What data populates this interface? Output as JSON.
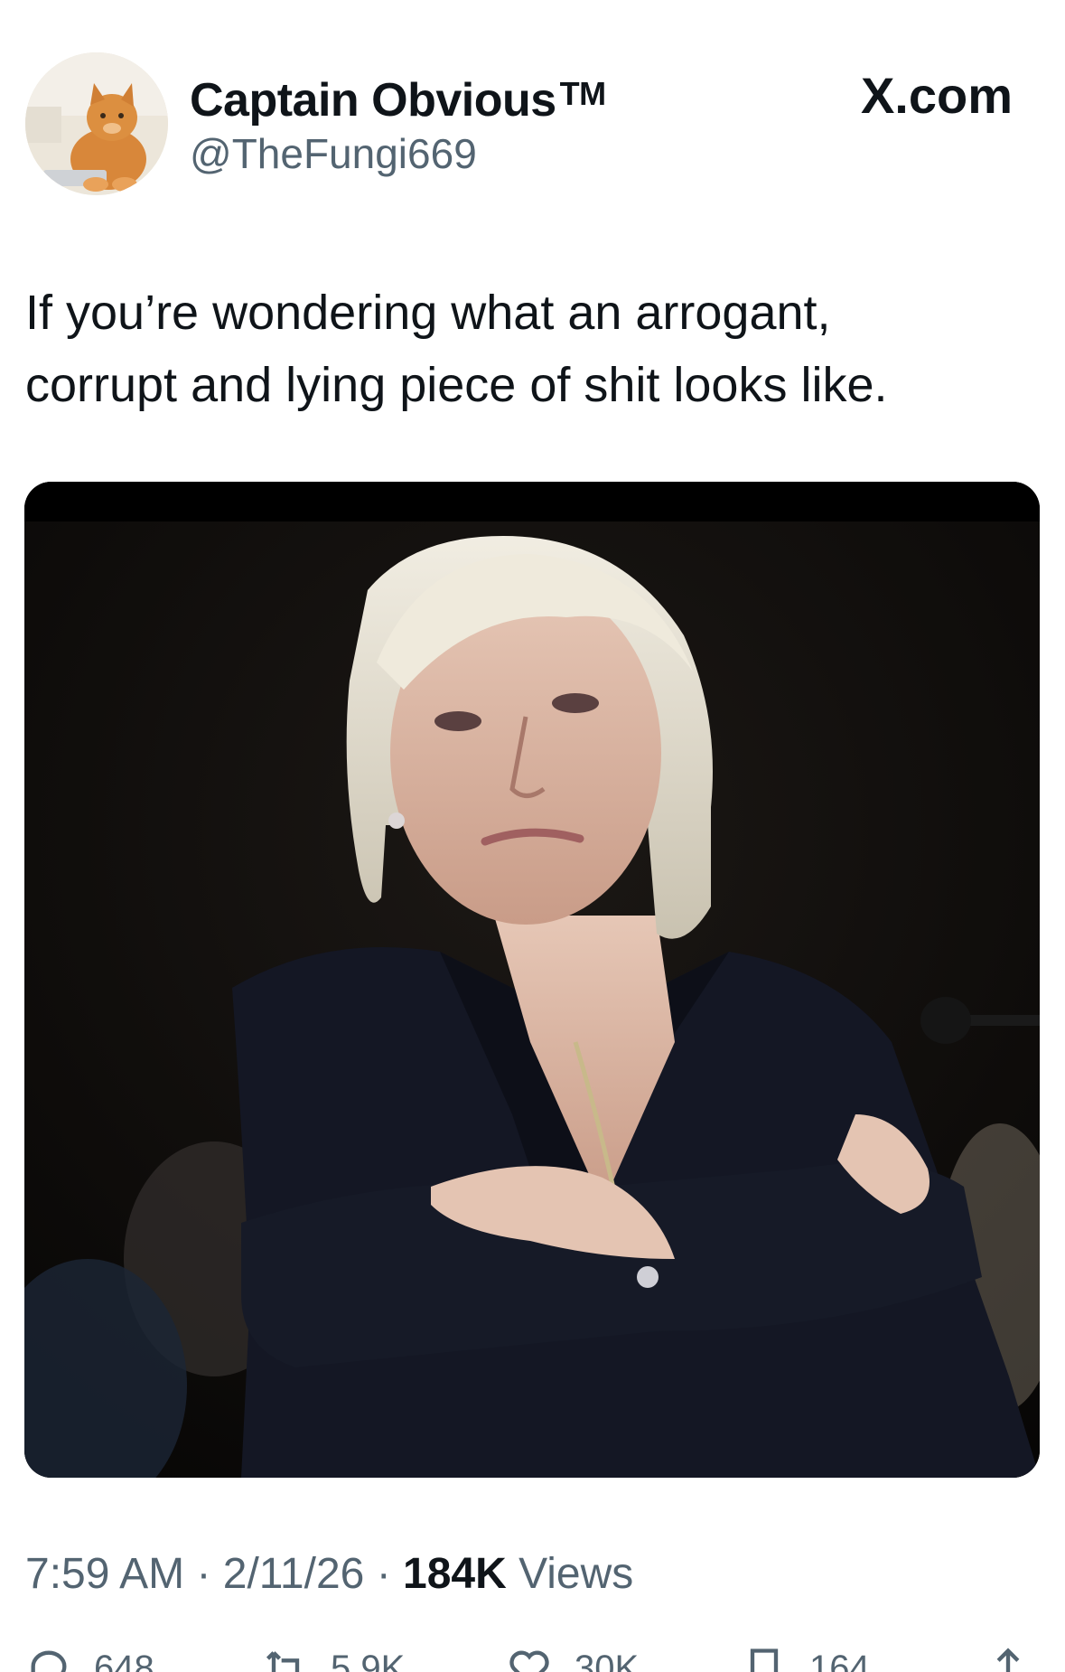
{
  "header": {
    "display_name": "Captain Obvious",
    "tm": "TM",
    "handle": "@TheFungi669",
    "site": "X.com"
  },
  "tweet": {
    "text_line1": "If you’re wondering what an arrogant,",
    "text_line2": "corrupt and lying piece of shit looks like."
  },
  "meta": {
    "time": "7:59 AM",
    "sep1": " · ",
    "date": "2/11/26",
    "sep2": " · ",
    "views_count": "184K",
    "views_label": " Views"
  },
  "actions": {
    "replies": "648",
    "reposts": "5.9K",
    "likes": "30K",
    "bookmarks": "164"
  },
  "icons": {
    "reply": "reply-icon",
    "repost": "repost-icon",
    "like": "heart-icon",
    "bookmark": "bookmark-icon",
    "share": "share-icon"
  }
}
